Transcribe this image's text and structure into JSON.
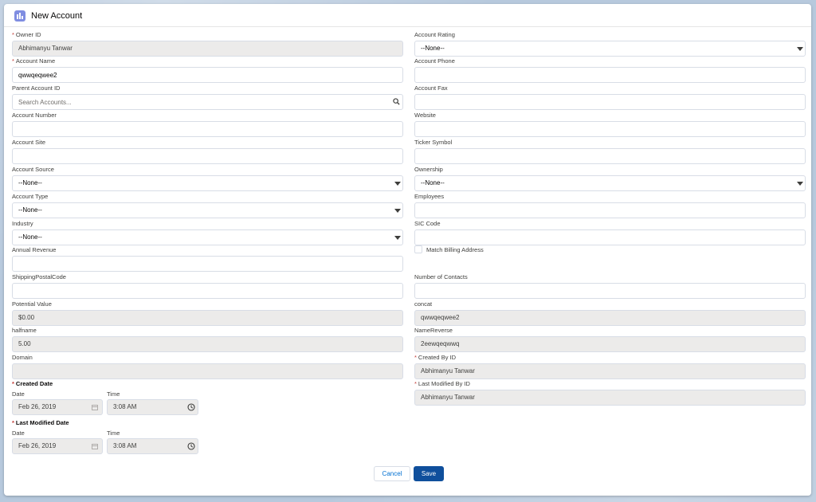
{
  "modal": {
    "title": "New Account"
  },
  "left": {
    "owner_id": {
      "label": "Owner ID",
      "value": "Abhimanyu Tanwar"
    },
    "account_name": {
      "label": "Account Name",
      "value": "qwwqeqwee2"
    },
    "parent_account": {
      "label": "Parent Account ID",
      "placeholder": "Search Accounts..."
    },
    "account_number": {
      "label": "Account Number",
      "value": ""
    },
    "account_site": {
      "label": "Account Site",
      "value": ""
    },
    "account_source": {
      "label": "Account Source",
      "value": "--None--"
    },
    "account_type": {
      "label": "Account Type",
      "value": "--None--"
    },
    "industry": {
      "label": "Industry",
      "value": "--None--"
    },
    "annual_revenue": {
      "label": "Annual Revenue",
      "value": ""
    },
    "shipping_postal": {
      "label": "ShippingPostalCode",
      "value": ""
    },
    "potential_value": {
      "label": "Potential Value",
      "value": "$0.00"
    },
    "halfname": {
      "label": "halfname",
      "value": "5.00"
    },
    "domain": {
      "label": "Domain",
      "value": ""
    },
    "created_date": {
      "label": "Created Date",
      "date_label": "Date",
      "time_label": "Time",
      "date": "Feb 26, 2019",
      "time": "3:08 AM"
    },
    "last_modified_date": {
      "label": "Last Modified Date",
      "date_label": "Date",
      "time_label": "Time",
      "date": "Feb 26, 2019",
      "time": "3:08 AM"
    }
  },
  "right": {
    "account_rating": {
      "label": "Account Rating",
      "value": "--None--"
    },
    "account_phone": {
      "label": "Account Phone",
      "value": ""
    },
    "account_fax": {
      "label": "Account Fax",
      "value": ""
    },
    "website": {
      "label": "Website",
      "value": ""
    },
    "ticker_symbol": {
      "label": "Ticker Symbol",
      "value": ""
    },
    "ownership": {
      "label": "Ownership",
      "value": "--None--"
    },
    "employees": {
      "label": "Employees",
      "value": ""
    },
    "sic_code": {
      "label": "SIC Code",
      "value": ""
    },
    "match_billing": {
      "label": "Match Billing Address"
    },
    "number_of_contacts": {
      "label": "Number of Contacts",
      "value": ""
    },
    "concat": {
      "label": "concat",
      "value": "qwwqeqwee2"
    },
    "name_reverse": {
      "label": "NameReverse",
      "value": "2eewqeqwwq"
    },
    "created_by": {
      "label": "Created By ID",
      "value": "Abhimanyu Tanwar"
    },
    "last_modified_by": {
      "label": "Last Modified By ID",
      "value": "Abhimanyu Tanwar"
    }
  },
  "footer": {
    "cancel_label": "Cancel",
    "save_label": "Save"
  },
  "required_marker": "*",
  "colors": {
    "brand": "#0f4f9c",
    "link": "#0070d2",
    "required": "#c23934",
    "readonly_bg": "#ecebea",
    "header_icon": "#7f8de1"
  }
}
